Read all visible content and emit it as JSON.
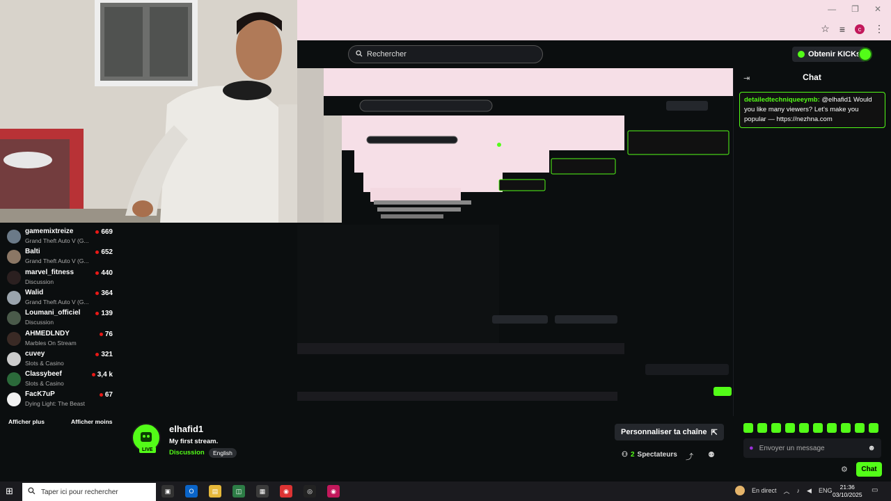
{
  "browser": {
    "window_controls": [
      "—",
      "❐",
      "✕"
    ],
    "profile_initial": "c",
    "toolbar_icons": [
      "star-icon",
      "playlist-icon",
      "profile-icon",
      "menu-icon"
    ]
  },
  "header": {
    "search_placeholder": "Rechercher",
    "kicks_label": "Obtenir KICKs"
  },
  "chat": {
    "title": "Chat",
    "messages": [
      {
        "user": "detailedtechniqueeymb:",
        "text": " @elhafid1 Would you like many viewers? Let's make you popular — https://nezhna.com"
      }
    ],
    "input_placeholder": "Envoyer un message",
    "send_label": "Chat",
    "emote_count": 10
  },
  "sidebar": {
    "items": [
      {
        "name": "gamemixtreize",
        "category": "Grand Theft Auto V (G...",
        "viewers": "669"
      },
      {
        "name": "Balti",
        "category": "Grand Theft Auto V (G...",
        "viewers": "652"
      },
      {
        "name": "marvel_fitness",
        "category": "Discussion",
        "viewers": "440"
      },
      {
        "name": "Walid",
        "category": "Grand Theft Auto V (G...",
        "viewers": "364"
      },
      {
        "name": "Loumani_officiel",
        "category": "Discussion",
        "viewers": "139"
      },
      {
        "name": "AHMEDLNDY",
        "category": "Marbles On Stream",
        "viewers": "76"
      },
      {
        "name": "cuvey",
        "category": "Slots & Casino",
        "viewers": "321"
      },
      {
        "name": "Classybeef",
        "category": "Slots & Casino",
        "viewers": "3,4 k"
      },
      {
        "name": "FacK7uP",
        "category": "Dying Light: The Beast",
        "viewers": "67"
      }
    ],
    "show_more": "Afficher plus",
    "show_less": "Afficher moins"
  },
  "channel": {
    "name": "elhafid1",
    "stream_title": "My first stream.",
    "category": "Discussion",
    "language": "English",
    "live_label": "LIVE",
    "customize_label": "Personnaliser ta chaîne",
    "spectators_count": "2",
    "spectators_label": "Spectateurs"
  },
  "taskbar": {
    "search_placeholder": "Taper ici pour rechercher",
    "live_status": "En direct",
    "lang": "ENG",
    "time": "21:36",
    "date": "03/10/2025"
  },
  "colors": {
    "accent": "#53fc18",
    "background": "#0b0e0f",
    "chrome": "#f6dfe7"
  }
}
